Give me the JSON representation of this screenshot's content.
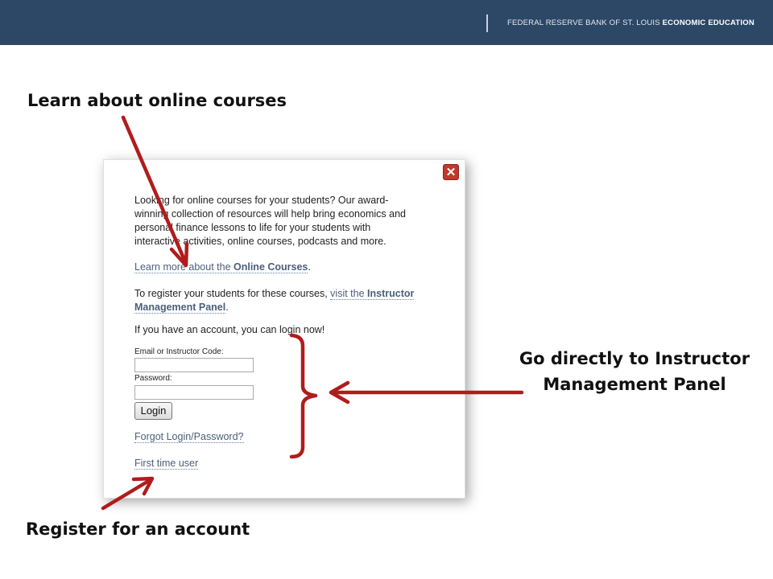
{
  "header": {
    "brand_prefix": "FEDERAL RESERVE BANK OF ST. LOUIS",
    "brand_suffix": "ECONOMIC EDUCATION",
    "bar_color": "#2d4766"
  },
  "annotations": {
    "learn": "Learn about online courses",
    "direct_line1": "Go directly to Instructor",
    "direct_line2": "Management Panel",
    "register": "Register for an account",
    "arrow_color": "#b01c1c"
  },
  "dialog": {
    "close_glyph": "✕",
    "intro_lines": [
      "Looking for online courses for your students? Our award-",
      "winning collection of resources will help bring economics and",
      "personal finance lessons to life for your students with",
      "interactive activities, online courses, podcasts and more."
    ],
    "learn_prefix": "Learn more about the ",
    "learn_bold": "Online Courses",
    "learn_suffix": ".",
    "register_prefix": "To register your students for these courses, ",
    "register_link": "visit the ",
    "register_link_bold_1": "Instructor",
    "register_link_bold_2": "Management Panel",
    "register_suffix": ".",
    "login_prompt": "If you have an account, you can login now!",
    "email_label": "Email or Instructor Code:",
    "email_value": "",
    "password_label": "Password:",
    "password_value": "",
    "login_button": "Login",
    "forgot_link": "Forgot Login/Password?",
    "first_time_link": "First time user"
  }
}
